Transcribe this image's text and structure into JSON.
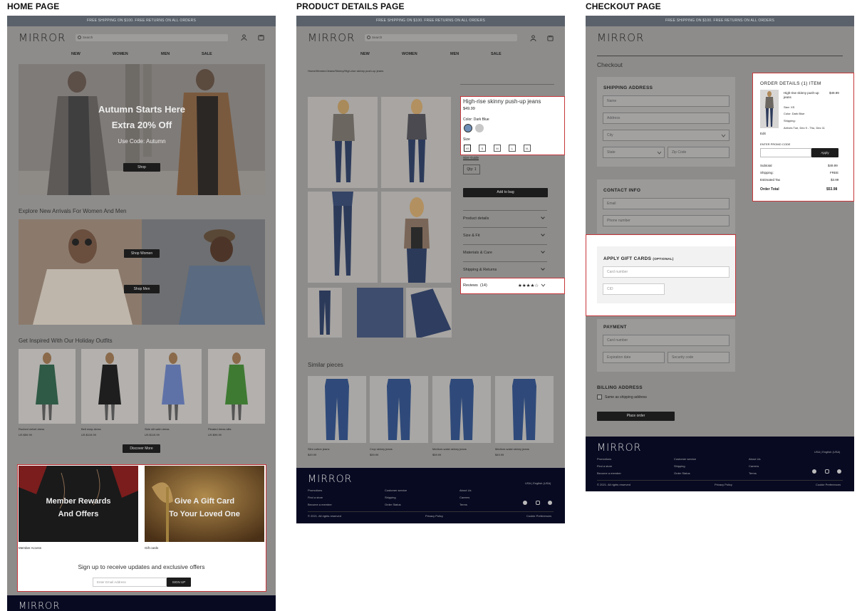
{
  "titles": {
    "home": "HOME PAGE",
    "product": "PRODUCT DETAILS PAGE",
    "checkout": "CHECKOUT PAGE"
  },
  "brand": "MIRROR",
  "banner_text": "FREE SHIPPING  ON $100. FREE RETURNS ON ALL ORDERS",
  "search_placeholder": "Search",
  "nav": [
    "NEW",
    "WOMEN",
    "MEN",
    "SALE"
  ],
  "home": {
    "hero_line1": "Autumn Starts Here",
    "hero_line2": "Extra 20% Off",
    "hero_code": "Use Code: Autumn",
    "hero_button": "Shop",
    "new_arrivals_title": "Explore New Arrivals For Women And Men",
    "shop_women": "Shop Women",
    "shop_men": "Shop Men",
    "holiday_title": "Get Inspired With Our Holiday Outfits",
    "outfits": [
      {
        "name": "Ruched velvet dress",
        "price": "US $59.99",
        "color": "#2f5a45"
      },
      {
        "name": "Belt wrap dress",
        "price": "US $119.99",
        "color": "#1e1e1e"
      },
      {
        "name": "Side slit satin dress",
        "price": "US $119.99",
        "color": "#5f72a8"
      },
      {
        "name": "Pleated dress slits",
        "price": "US $99.99",
        "color": "#3f7a33"
      }
    ],
    "discover_button": "Discover More",
    "rewards_line1": "Member Rewards",
    "rewards_line2": "And Offers",
    "rewards_caption": "Member Access",
    "gift_line1": "Give A Gift Card",
    "gift_line2": "To Your Loved One",
    "gift_caption": "Gift cards",
    "signup_text": "Sign up to receive updates and exclusive offers",
    "email_placeholder": "Enter Email Address",
    "signup_button": "SIGN UP"
  },
  "product": {
    "breadcrumb": "Home/Women/Jeans/Skinny/High-rise skinny push-up jeans",
    "name": "High-rise skinny push-up jeans",
    "price": "$49.99",
    "color_label": "Color: Dark Blue",
    "size_label": "Size",
    "sizes": [
      "XS",
      "S",
      "M",
      "L",
      "XL"
    ],
    "size_guide": "Size Guide",
    "qty": "Qty: 1",
    "add_to_bag": "Add to bag",
    "accordions": [
      "Product details",
      "Size & Fit",
      "Materials & Care",
      "Shipping & Returns"
    ],
    "reviews_label": "Reviews",
    "reviews_count": "(14)",
    "rating": 4,
    "stars": "★★★★☆",
    "similar_title": "Similar pieces",
    "similar": [
      {
        "name": "Slim cotton jeans",
        "price": "$49.99"
      },
      {
        "name": "Crop skinny jeans",
        "price": "$59.99"
      },
      {
        "name": "Medium-waist skinny jeans",
        "price": "$59.99"
      },
      {
        "name": "Medium-waist skinny jeans",
        "price": "$49.99"
      }
    ]
  },
  "checkout": {
    "title": "Checkout",
    "shipping_heading": "SHIPPING ADDRESS",
    "shipping_fields": {
      "name": "Name",
      "address": "Address",
      "city": "City",
      "state": "State",
      "zip": "Zip Code"
    },
    "contact_heading": "CONTACT INFO",
    "contact_fields": {
      "email": "Email",
      "phone": "Phone number"
    },
    "gift_heading": "APPLY GIFT CARDS",
    "gift_optional": "(OPTIONAL)",
    "gift_fields": {
      "card": "Card number",
      "cid": "CID"
    },
    "payment_heading": "PAYMENT",
    "payment_fields": {
      "card": "Card number",
      "exp": "Expiration date",
      "code": "Security code"
    },
    "billing_heading": "BILLING ADDRESS",
    "billing_same": "Same as shipping address",
    "place_order": "Place order",
    "order": {
      "heading": "ORDER DETAILS (1) ITEM",
      "item_name": "High-rise skinny push-up jeans",
      "item_price": "$49.99",
      "size": "Size: XS",
      "color": "Color: Dark Blue",
      "shipping": "Shipping:",
      "arrives": "Arrives Tue, Dec 9 - Thu, Dec 11",
      "edit": "Edit",
      "promo_label": "ENTER PROMO CODE",
      "apply": "Apply",
      "subtotal_label": "Subtotal",
      "subtotal": "$49.99",
      "ship_label": "Shipping:",
      "ship": "FREE",
      "tax_label": "Estimated Tax",
      "tax": "$3.99",
      "total_label": "Order Total",
      "total": "$53.98"
    }
  },
  "footer": {
    "col1": [
      "Promotions",
      "Find a store",
      "Become a member"
    ],
    "col2": [
      "Customer service",
      "Shipping",
      "Order Status"
    ],
    "col3": [
      "About Us",
      "Careers",
      "Terms"
    ],
    "region": "USA | English (USA)",
    "copyright": "© 2021. All rights reserved",
    "privacy": "Privacy Policy",
    "cookie": "Cookie Preferences"
  },
  "colors": {
    "accent_red": "#c8373b",
    "banner": "#5a616a",
    "footer": "#080a22",
    "dark_button": "#1c1c1c"
  }
}
